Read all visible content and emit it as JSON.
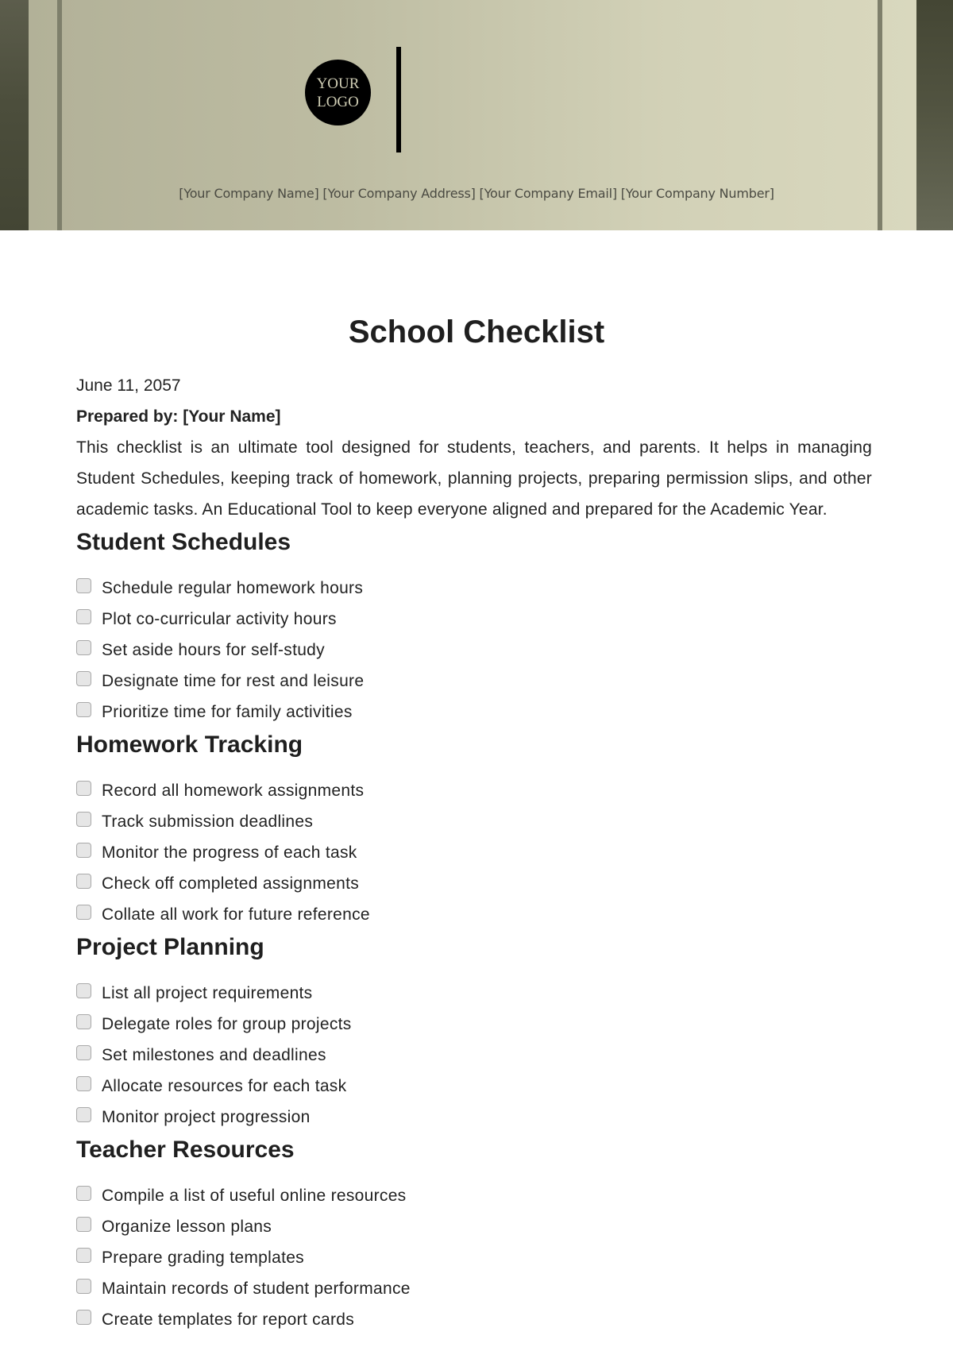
{
  "header": {
    "logo_line1": "YOUR",
    "logo_line2": "LOGO",
    "company_info": "[Your Company Name] [Your Company Address] [Your Company Email] [Your Company Number]",
    "colors": {
      "banner_light": "#d2d1b7",
      "banner_dark": "#4c4e3c",
      "rule": "#7e7f6b"
    }
  },
  "document": {
    "title": "School Checklist",
    "date": "June 11, 2057",
    "prepared_by": "Prepared by: [Your Name]",
    "intro": "This checklist is an ultimate tool designed for students, teachers, and parents. It helps in managing Student Schedules, keeping track of homework, planning projects, preparing permission slips, and other academic tasks. An Educational Tool to keep everyone aligned and prepared for the Academic Year."
  },
  "sections": [
    {
      "title": "Student Schedules",
      "items": [
        {
          "label": "Schedule regular homework hours",
          "checked": false
        },
        {
          "label": "Plot co-curricular activity hours",
          "checked": false
        },
        {
          "label": "Set aside hours for self-study",
          "checked": false
        },
        {
          "label": "Designate time for rest and leisure",
          "checked": false
        },
        {
          "label": "Prioritize time for family activities",
          "checked": false
        }
      ]
    },
    {
      "title": "Homework Tracking",
      "items": [
        {
          "label": "Record all homework assignments",
          "checked": false
        },
        {
          "label": "Track submission deadlines",
          "checked": false
        },
        {
          "label": "Monitor the progress of each task",
          "checked": false
        },
        {
          "label": "Check off completed assignments",
          "checked": false
        },
        {
          "label": "Collate all work for future reference",
          "checked": false
        }
      ]
    },
    {
      "title": "Project Planning",
      "items": [
        {
          "label": "List all project requirements",
          "checked": false
        },
        {
          "label": "Delegate roles for group projects",
          "checked": false
        },
        {
          "label": "Set milestones and deadlines",
          "checked": false
        },
        {
          "label": "Allocate resources for each task",
          "checked": false
        },
        {
          "label": "Monitor project progression",
          "checked": false
        }
      ]
    },
    {
      "title": "Teacher Resources",
      "items": [
        {
          "label": "Compile a list of useful online resources",
          "checked": false
        },
        {
          "label": "Organize lesson plans",
          "checked": false
        },
        {
          "label": "Prepare grading templates",
          "checked": false
        },
        {
          "label": "Maintain records of student performance",
          "checked": false
        },
        {
          "label": "Create templates for report cards",
          "checked": false
        }
      ]
    }
  ]
}
